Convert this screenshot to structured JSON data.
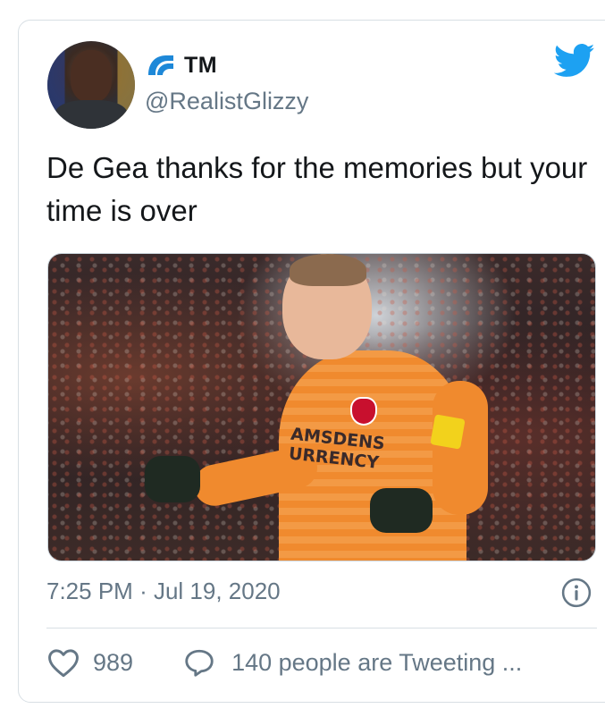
{
  "author": {
    "display_name": "TM",
    "handle": "@RealistGlizzy",
    "avatar_alt": "avatar"
  },
  "tweet": {
    "text": "De Gea thanks for the memories but your time is over",
    "media": {
      "sponsor_line1": "AMSDENS",
      "sponsor_line2": "URRENCY"
    },
    "time": "7:25 PM",
    "separator": "·",
    "date": "Jul 19, 2020"
  },
  "engagement": {
    "likes": "989",
    "tweeting_text": "140 people are Tweeting ..."
  },
  "colors": {
    "twitter_blue": "#1da1f2",
    "muted": "#657786",
    "text": "#14171a",
    "border": "#d8dfe4"
  },
  "icons": [
    "twitter-bird-icon",
    "wave-logo-icon",
    "info-icon",
    "heart-icon",
    "chat-bubble-icon"
  ]
}
